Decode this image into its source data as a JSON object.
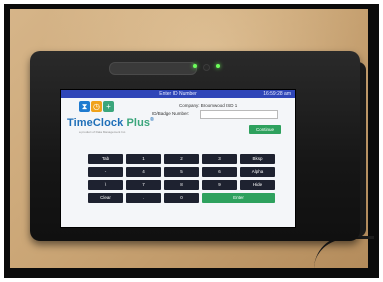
{
  "screen": {
    "title": "Enter ID Number",
    "time": "16:59:28 am",
    "brand": {
      "name": "TimeClock",
      "plus": " Plus",
      "reg": "®",
      "tagline": "a product of Data Management Inc."
    },
    "company_line": "Company: Broomwood ISD  1",
    "id_label": "ID/Badge Number:",
    "id_value": "",
    "continue_label": "Continue"
  },
  "keypad": {
    "rows": [
      [
        "Tab",
        "1",
        "2",
        "3",
        "Bksp"
      ],
      [
        "-",
        "4",
        "5",
        "6",
        "Alpha"
      ],
      [
        "\\",
        "7",
        "8",
        "9",
        "Hide"
      ],
      [
        "Clear",
        ".",
        "0",
        "Enter"
      ]
    ]
  },
  "colors": {
    "titlebar": "#2f46b8",
    "brand_blue": "#1f6fb8",
    "accent_green": "#2ea15e",
    "key_dark": "#1e2230"
  },
  "icons": [
    "hourglass-icon",
    "clock-icon",
    "plus-icon"
  ]
}
